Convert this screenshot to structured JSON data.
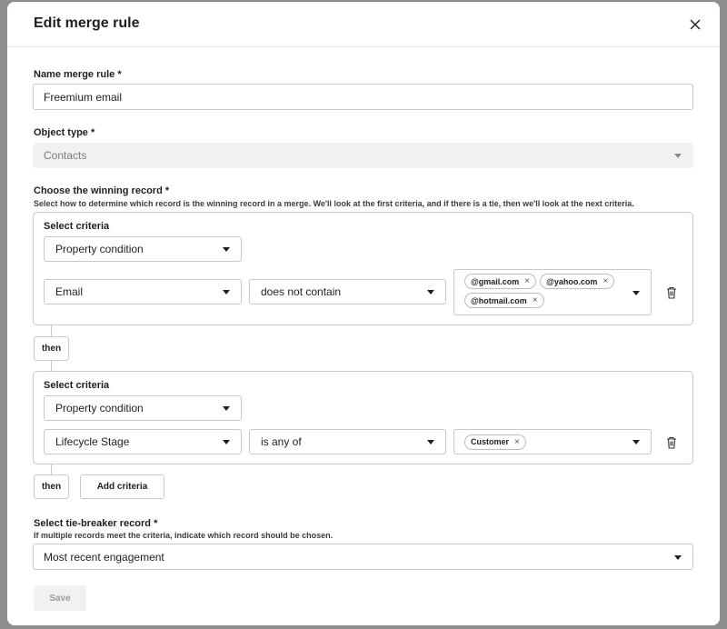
{
  "modal": {
    "title": "Edit merge rule"
  },
  "name_field": {
    "label": "Name merge rule *",
    "value": "Freemium email"
  },
  "object_type": {
    "label": "Object type *",
    "value": "Contacts"
  },
  "winning_record": {
    "label": "Choose the winning record *",
    "help": "Select how to determine which record is the winning record in a merge. We'll look at the first criteria, and if there is a tie, then we'll look at the next criteria."
  },
  "criteria": [
    {
      "title": "Select criteria",
      "type": "Property condition",
      "property": "Email",
      "operator": "does not contain",
      "values": [
        "@gmail.com",
        "@yahoo.com",
        "@hotmail.com"
      ]
    },
    {
      "title": "Select criteria",
      "type": "Property condition",
      "property": "Lifecycle Stage",
      "operator": "is any of",
      "values": [
        "Customer"
      ]
    }
  ],
  "then_label": "then",
  "add_criteria_label": "Add criteria",
  "tie_breaker": {
    "label": "Select tie-breaker record *",
    "help": "If multiple records meet the criteria, indicate which record should be chosen.",
    "value": "Most recent engagement"
  },
  "save_label": "Save",
  "icons": {
    "close": "close-icon",
    "caret": "chevron-down-icon",
    "trash": "trash-icon",
    "tag_remove": "x-icon"
  }
}
